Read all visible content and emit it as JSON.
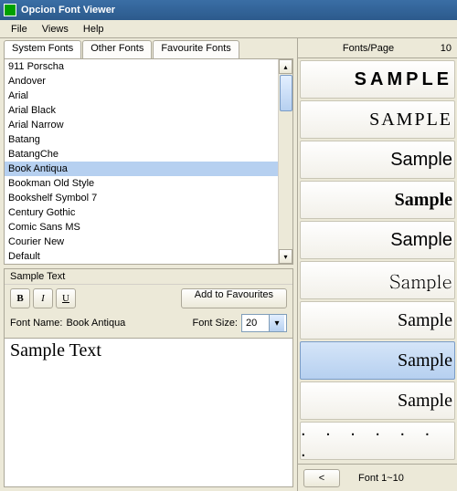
{
  "title": "Opcion Font Viewer",
  "menu": [
    "File",
    "Views",
    "Help"
  ],
  "tabs": [
    "System Fonts",
    "Other Fonts",
    "Favourite Fonts"
  ],
  "activeTab": 0,
  "fonts": [
    "911 Porscha",
    "Andover",
    "Arial",
    "Arial Black",
    "Arial Narrow",
    "Batang",
    "BatangChe",
    "Book Antiqua",
    "Bookman Old Style",
    "Bookshelf Symbol 7",
    "Century Gothic",
    "Comic Sans MS",
    "Courier New",
    "Default"
  ],
  "selectedFontIndex": 7,
  "sampleSection": {
    "header": "Sample Text",
    "boldLabel": "B",
    "italicLabel": "I",
    "underlineLabel": "U",
    "addFavLabel": "Add to Favourites",
    "fontNameLabel": "Font Name:",
    "fontNameValue": "Book Antiqua",
    "fontSizeLabel": "Font Size:",
    "fontSizeValue": "20",
    "sampleText": "Sample Text"
  },
  "rightPanel": {
    "headerLabel": "Fonts/Page",
    "headerValue": "10",
    "previews": [
      "SAMPLE",
      "SAMPLE ",
      "Sample",
      "Sample",
      "Sample",
      "Sample",
      "Sample",
      "Sample",
      "Sample",
      ". . . . . . ."
    ],
    "selectedPreview": 7,
    "navPrev": "<",
    "rangeLabel": "Font 1~10"
  }
}
